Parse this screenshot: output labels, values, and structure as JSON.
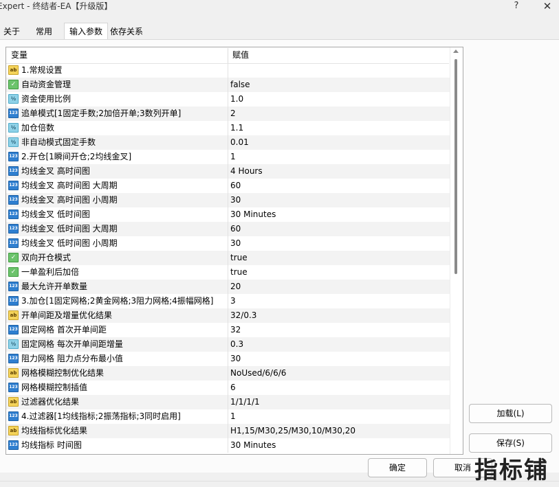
{
  "window": {
    "title": "Expert - 终结者-EA【升级版】",
    "help": "?",
    "close": "✕"
  },
  "tabs": [
    {
      "label": "关于"
    },
    {
      "label": "常用"
    },
    {
      "label": "输入参数"
    },
    {
      "label": "依存关系"
    }
  ],
  "grid": {
    "col_name": "变量",
    "col_value": "赋值",
    "rows": [
      {
        "icon": "string-icon",
        "name": "1.常规设置",
        "value": ""
      },
      {
        "icon": "bool-icon",
        "name": "自动资金管理",
        "value": "false"
      },
      {
        "icon": "double-icon",
        "name": "资金使用比例",
        "value": "1.0"
      },
      {
        "icon": "int-icon",
        "name": "追单模式[1固定手数;2加倍开单;3数列开单]",
        "value": "2"
      },
      {
        "icon": "double-icon",
        "name": "加仓倍数",
        "value": "1.1"
      },
      {
        "icon": "double-icon",
        "name": "非自动模式固定手数",
        "value": "0.01"
      },
      {
        "icon": "int-icon",
        "name": "2.开仓[1瞬间开仓;2均线金叉]",
        "value": "1"
      },
      {
        "icon": "int-icon",
        "name": "均线金叉 高时间图",
        "value": "4 Hours"
      },
      {
        "icon": "int-icon",
        "name": "均线金叉 高时间图 大周期",
        "value": "60"
      },
      {
        "icon": "int-icon",
        "name": "均线金叉 高时间图 小周期",
        "value": "30"
      },
      {
        "icon": "int-icon",
        "name": "均线金叉 低时间图",
        "value": "30 Minutes"
      },
      {
        "icon": "int-icon",
        "name": "均线金叉 低时间图 大周期",
        "value": "60"
      },
      {
        "icon": "int-icon",
        "name": "均线金叉 低时间图 小周期",
        "value": "30"
      },
      {
        "icon": "bool-icon",
        "name": "双向开仓模式",
        "value": "true"
      },
      {
        "icon": "bool-icon",
        "name": "一单盈利后加倍",
        "value": "true"
      },
      {
        "icon": "int-icon",
        "name": "最大允许开单数量",
        "value": "20"
      },
      {
        "icon": "int-icon",
        "name": "3.加仓[1固定网格;2黄金网格;3阻力网格;4振幅网格]",
        "value": "3"
      },
      {
        "icon": "string-icon",
        "name": "开单间距及增量优化结果",
        "value": "32/0.3"
      },
      {
        "icon": "int-icon",
        "name": "固定网格 首次开单间距",
        "value": "32"
      },
      {
        "icon": "double-icon",
        "name": "固定网格 每次开单间距增量",
        "value": "0.3"
      },
      {
        "icon": "int-icon",
        "name": "阻力网格 阻力点分布最小值",
        "value": "30"
      },
      {
        "icon": "string-icon",
        "name": "网格模糊控制优化结果",
        "value": "NoUsed/6/6/6"
      },
      {
        "icon": "int-icon",
        "name": "网格模糊控制插值",
        "value": "6"
      },
      {
        "icon": "string-icon",
        "name": "过滤器优化结果",
        "value": "1/1/1/1"
      },
      {
        "icon": "int-icon",
        "name": "4.过滤器[1均线指标;2振荡指标;3同时启用]",
        "value": "1"
      },
      {
        "icon": "string-icon",
        "name": "均线指标优化结果",
        "value": "H1,15/M30,25/M30,10/M30,20"
      },
      {
        "icon": "int-icon",
        "name": "均线指标 时间图",
        "value": "30 Minutes"
      }
    ]
  },
  "icon_glyphs": {
    "string-icon": "ab",
    "bool-icon": "✓",
    "int-icon": "123",
    "double-icon": "½"
  },
  "buttons": {
    "load": "加载(L)",
    "save": "保存(S)",
    "ok": "确定",
    "cancel": "取消"
  },
  "watermark": "指标铺"
}
